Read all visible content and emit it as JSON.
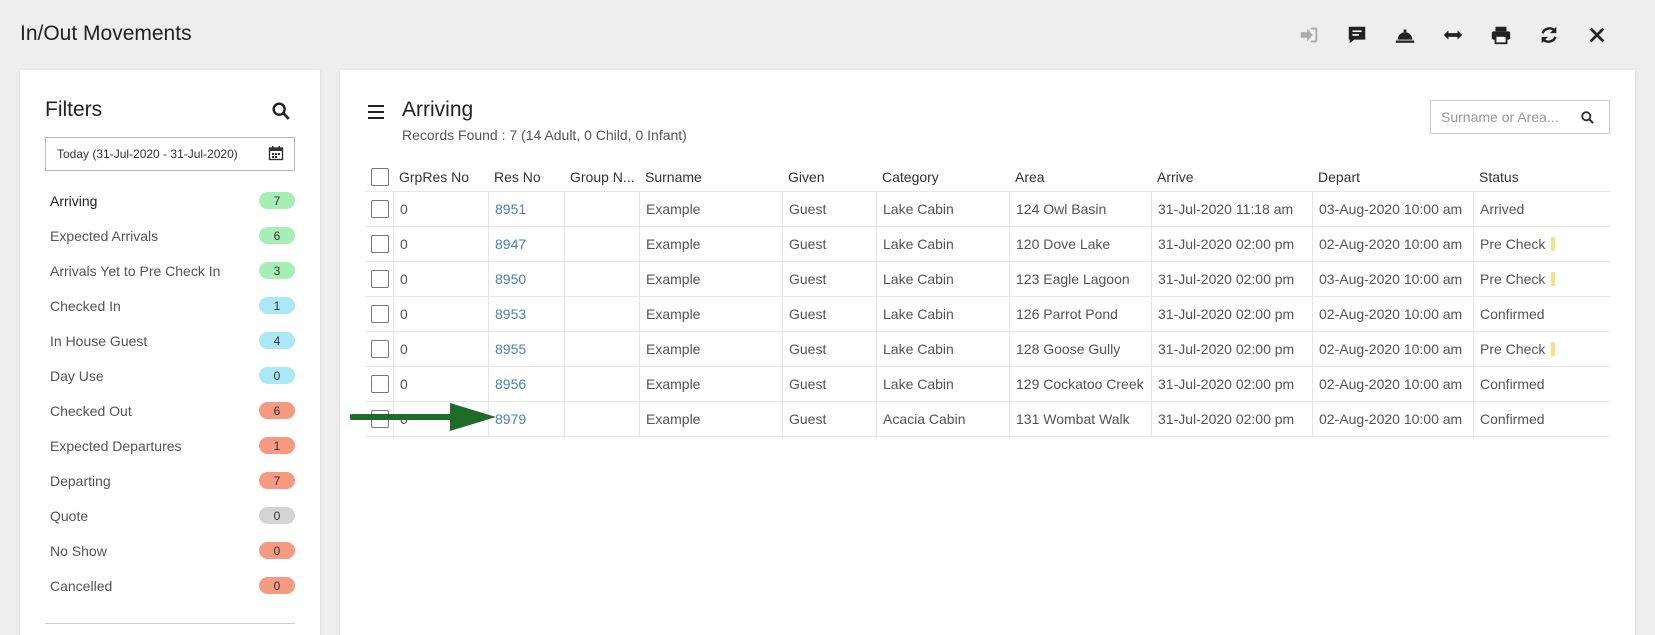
{
  "header": {
    "title": "In/Out Movements"
  },
  "filters": {
    "title": "Filters",
    "date_range": "Today (31-Jul-2020 - 31-Jul-2020)",
    "items": [
      {
        "label": "Arriving",
        "count": "7",
        "color": "green"
      },
      {
        "label": "Expected Arrivals",
        "count": "6",
        "color": "green"
      },
      {
        "label": "Arrivals Yet to Pre Check In",
        "count": "3",
        "color": "green"
      },
      {
        "label": "Checked In",
        "count": "1",
        "color": "cyan"
      },
      {
        "label": "In House Guest",
        "count": "4",
        "color": "cyan"
      },
      {
        "label": "Day Use",
        "count": "0",
        "color": "cyan"
      },
      {
        "label": "Checked Out",
        "count": "6",
        "color": "red"
      },
      {
        "label": "Expected Departures",
        "count": "1",
        "color": "red"
      },
      {
        "label": "Departing",
        "count": "7",
        "color": "red"
      },
      {
        "label": "Quote",
        "count": "0",
        "color": "grey"
      },
      {
        "label": "No Show",
        "count": "0",
        "color": "red"
      },
      {
        "label": "Cancelled",
        "count": "0",
        "color": "red"
      }
    ]
  },
  "main": {
    "title": "Arriving",
    "records": "Records Found : 7 (14 Adult, 0 Child, 0 Infant)",
    "search_placeholder": "Surname or Area...",
    "columns": [
      "GrpRes No",
      "Res No",
      "Group N...",
      "Surname",
      "Given",
      "Category",
      "Area",
      "Arrive",
      "Depart",
      "Status"
    ],
    "rows": [
      [
        "0",
        "8951",
        "",
        "Example",
        "Guest",
        "Lake Cabin",
        "124 Owl Basin",
        "31-Jul-2020 11:18 am",
        "03-Aug-2020 10:00 am",
        "Arrived"
      ],
      [
        "0",
        "8947",
        "",
        "Example",
        "Guest",
        "Lake Cabin",
        "120 Dove Lake",
        "31-Jul-2020 02:00 pm",
        "02-Aug-2020 10:00 am",
        "Pre Check"
      ],
      [
        "0",
        "8950",
        "",
        "Example",
        "Guest",
        "Lake Cabin",
        "123 Eagle Lagoon",
        "31-Jul-2020 02:00 pm",
        "03-Aug-2020 10:00 am",
        "Pre Check"
      ],
      [
        "0",
        "8953",
        "",
        "Example",
        "Guest",
        "Lake Cabin",
        "126 Parrot Pond",
        "31-Jul-2020 02:00 pm",
        "02-Aug-2020 10:00 am",
        "Confirmed"
      ],
      [
        "0",
        "8955",
        "",
        "Example",
        "Guest",
        "Lake Cabin",
        "128 Goose Gully",
        "31-Jul-2020 02:00 pm",
        "02-Aug-2020 10:00 am",
        "Pre Check"
      ],
      [
        "0",
        "8956",
        "",
        "Example",
        "Guest",
        "Lake Cabin",
        "129 Cockatoo Creek",
        "31-Jul-2020 02:00 pm",
        "02-Aug-2020 10:00 am",
        "Confirmed"
      ],
      [
        "0",
        "8979",
        "",
        "Example",
        "Guest",
        "Acacia Cabin",
        "131 Wombat Walk",
        "31-Jul-2020 02:00 pm",
        "02-Aug-2020 10:00 am",
        "Confirmed"
      ]
    ]
  },
  "colors": {
    "link": "#4b7fbf",
    "arrow": "#1f6b2a",
    "badge_green": "#a6eeb5",
    "badge_cyan": "#aae7f7",
    "badge_red": "#f69a82",
    "badge_grey": "#d4d4d4"
  }
}
